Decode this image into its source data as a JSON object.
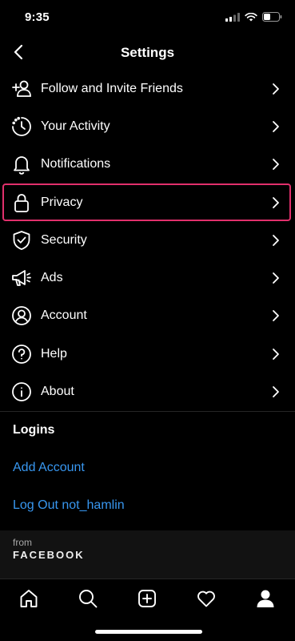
{
  "status_bar": {
    "time": "9:35"
  },
  "header": {
    "title": "Settings"
  },
  "menu": {
    "items": [
      {
        "label": "Follow and Invite Friends",
        "icon": "add-person-icon"
      },
      {
        "label": "Your Activity",
        "icon": "activity-icon"
      },
      {
        "label": "Notifications",
        "icon": "bell-icon"
      },
      {
        "label": "Privacy",
        "icon": "lock-icon",
        "highlighted": true
      },
      {
        "label": "Security",
        "icon": "shield-icon"
      },
      {
        "label": "Ads",
        "icon": "megaphone-icon"
      },
      {
        "label": "Account",
        "icon": "account-icon"
      },
      {
        "label": "Help",
        "icon": "help-icon"
      },
      {
        "label": "About",
        "icon": "info-icon"
      }
    ]
  },
  "logins": {
    "title": "Logins",
    "add_account": "Add Account",
    "log_out": "Log Out not_hamlin"
  },
  "footer": {
    "from": "from",
    "company": "FACEBOOK"
  },
  "colors": {
    "accent_link": "#3897f0",
    "highlight": "#e1306c"
  }
}
